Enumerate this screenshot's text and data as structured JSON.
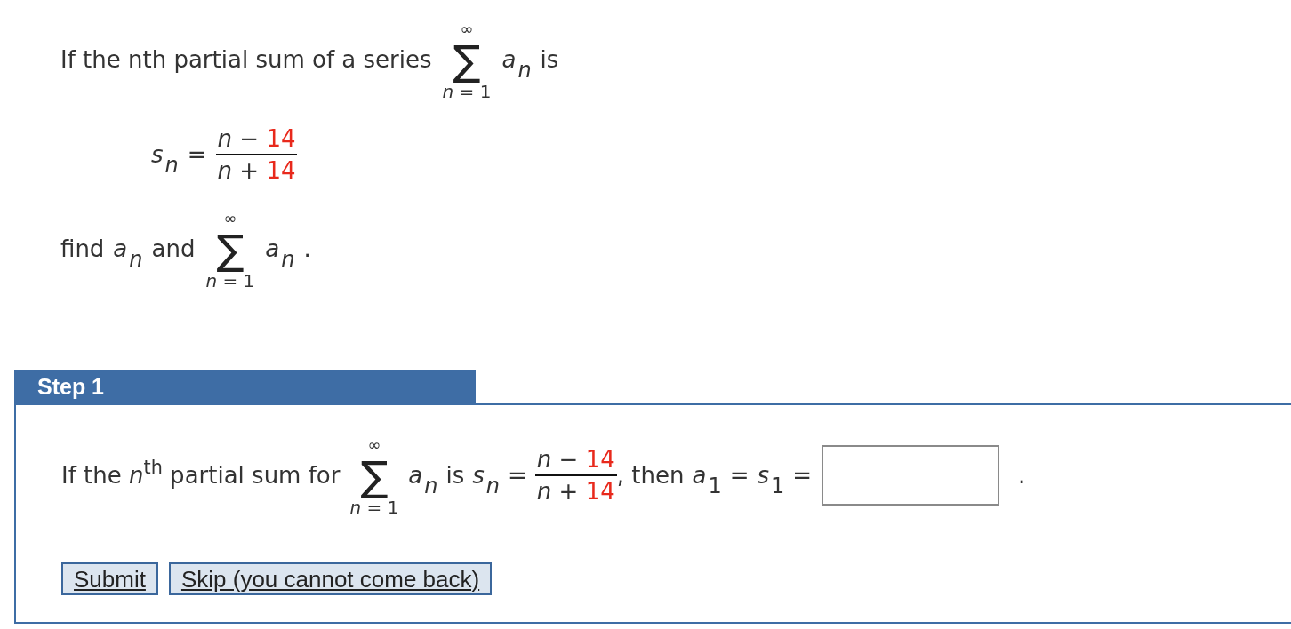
{
  "question": {
    "intro": [
      {
        "kind": "text",
        "text": "If the nth partial sum of a series"
      },
      {
        "kind": "sum",
        "upper": "∞",
        "symbol": "∑",
        "lower": "*n* = 1"
      },
      {
        "kind": "variable",
        "name": "a",
        "index": "n"
      },
      {
        "kind": "text",
        "text": "is"
      }
    ],
    "formula": [
      {
        "kind": "variable",
        "name": "s",
        "index": "n"
      },
      {
        "kind": "text",
        "text": "="
      },
      {
        "kind": "fraction",
        "numerator": {
          "expression": "*n* −",
          "number": "14"
        },
        "denominator": {
          "expression": "*n* +",
          "number": "14"
        }
      }
    ],
    "task": [
      {
        "kind": "text",
        "text": "find"
      },
      {
        "kind": "variable",
        "name": "a",
        "index": "n"
      },
      {
        "kind": "text",
        "text": "and"
      },
      {
        "kind": "sum",
        "upper": "∞",
        "symbol": "∑",
        "lower": "*n* = 1"
      },
      {
        "kind": "variable",
        "name": "a",
        "index": "n"
      },
      {
        "kind": "text",
        "text": "."
      }
    ]
  },
  "step": {
    "title": "Step 1",
    "statement": [
      {
        "kind": "text",
        "text": "If the *n*$^{th}$ partial sum for"
      },
      {
        "kind": "sum",
        "upper": "∞",
        "symbol": "∑",
        "lower": "*n* = 1"
      },
      {
        "kind": "variable",
        "name": "a",
        "index": "n"
      },
      {
        "kind": "text",
        "text": "is"
      },
      {
        "kind": "variable",
        "name": "s",
        "index": "n"
      },
      {
        "kind": "text",
        "text": "="
      },
      {
        "kind": "fraction",
        "numerator": {
          "expression": "*n* −",
          "number": "14"
        },
        "denominator": {
          "expression": "*n* +",
          "number": "14"
        }
      },
      {
        "kind": "text",
        "text": ", then"
      },
      {
        "kind": "variable",
        "name": "a",
        "index": "1"
      },
      {
        "kind": "text",
        "text": "="
      },
      {
        "kind": "variable",
        "name": "s",
        "index": "1"
      },
      {
        "kind": "text",
        "text": "="
      },
      {
        "kind": "field"
      },
      {
        "kind": "text",
        "text": "."
      }
    ],
    "buttons": [
      {
        "label": "Submit"
      },
      {
        "label": "Skip (you cannot come back)"
      }
    ]
  }
}
